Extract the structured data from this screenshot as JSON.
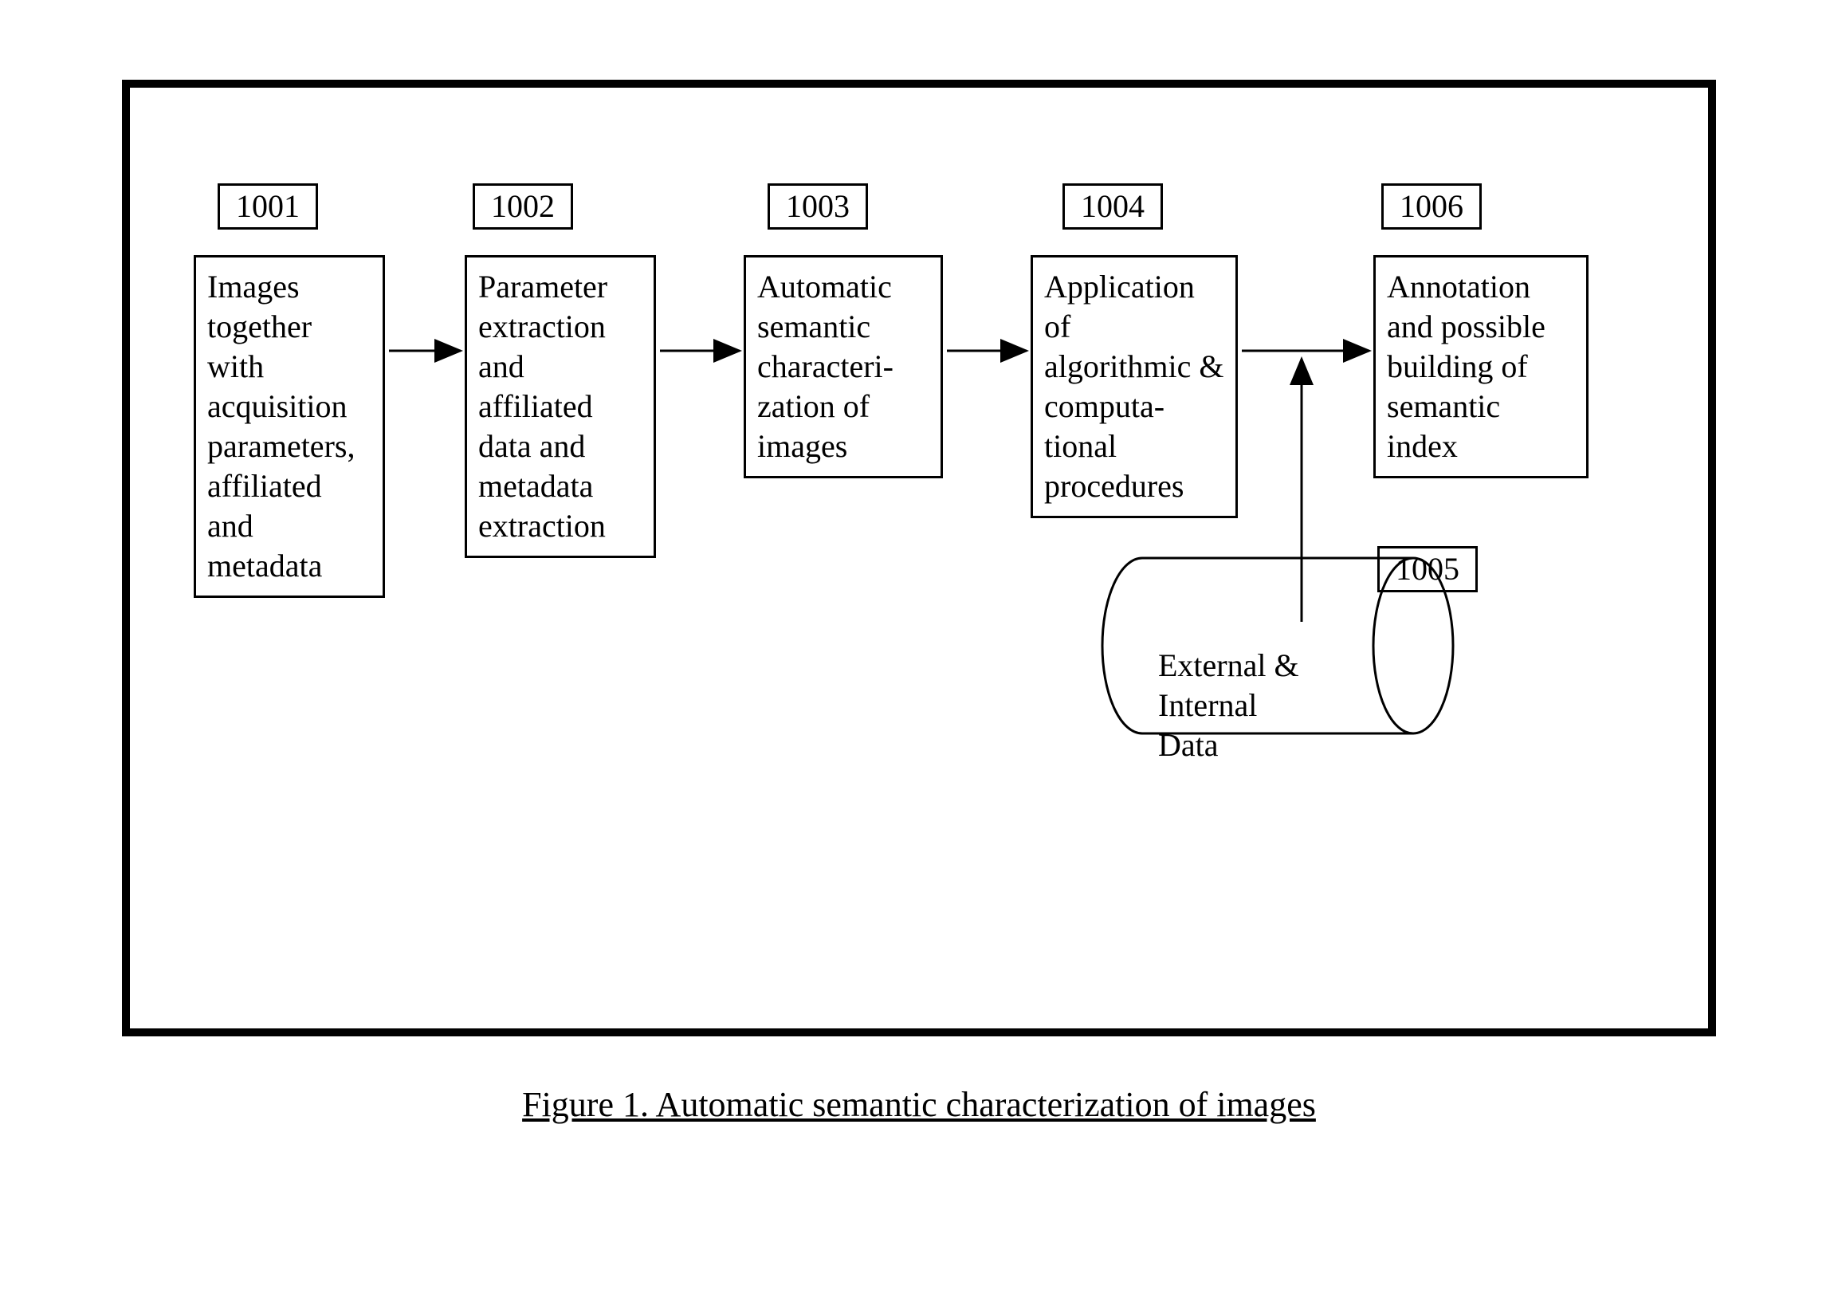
{
  "caption": "Figure 1.  Automatic semantic characterization of images",
  "refs": {
    "r1001": "1001",
    "r1002": "1002",
    "r1003": "1003",
    "r1004": "1004",
    "r1005": "1005",
    "r1006": "1006"
  },
  "boxes": {
    "b1001": "Images together with acquisition parameters, affiliated and metadata",
    "b1002": "Parameter extraction and affiliated data and metadata extraction",
    "b1003": "Automatic semantic characteri-zation of images",
    "b1004": "Application of algorithmic & computa-tional procedures",
    "b1006": "Annotation and possible building of semantic index"
  },
  "cylinder": {
    "label": "External & Internal Data"
  }
}
